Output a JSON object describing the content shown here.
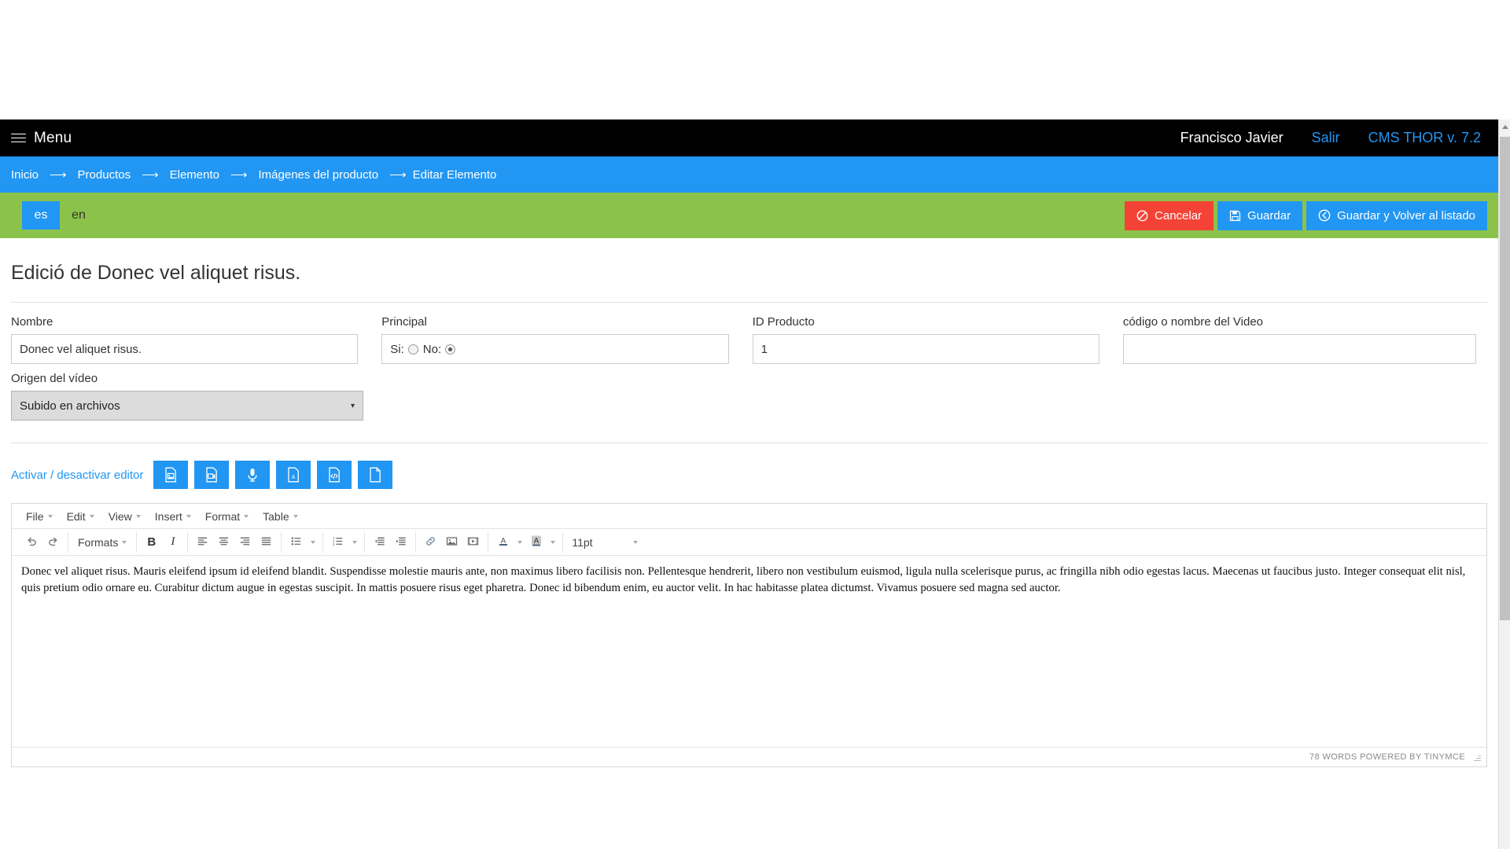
{
  "navbar": {
    "menu_label": "Menu",
    "menu_icon": "hamburger-icon",
    "user": "Francisco Javier",
    "logout": "Salir",
    "version": "CMS THOR v. 7.2"
  },
  "breadcrumb": {
    "separator": "⟶",
    "items": [
      {
        "label": "Inicio"
      },
      {
        "label": "Productos"
      },
      {
        "label": "Elemento"
      },
      {
        "label": "Imágenes del producto"
      },
      {
        "label": "Editar Elemento"
      }
    ]
  },
  "actionbar": {
    "languages": [
      {
        "code": "es",
        "active": true
      },
      {
        "code": "en",
        "active": false
      }
    ],
    "buttons": [
      {
        "label": "Cancelar",
        "icon": "ban-icon",
        "color": "#f44336"
      },
      {
        "label": "Guardar",
        "icon": "floppy-save-icon",
        "color": "#2196f3"
      },
      {
        "label": "Guardar y Volver al listado",
        "icon": "arrow-circle-left-icon",
        "color": "#2196f3"
      }
    ]
  },
  "page": {
    "title": "Edició de Donec vel aliquet risus."
  },
  "form": {
    "nombre": {
      "label": "Nombre",
      "value": "Donec vel aliquet risus.",
      "placeholder": ""
    },
    "principal": {
      "label": "Principal",
      "si_label": "Si:",
      "no_label": "No:",
      "si_checked": false,
      "no_checked": true
    },
    "id_producto": {
      "label": "ID Producto",
      "value": "1",
      "placeholder": ""
    },
    "codigo_video": {
      "label": "código o nombre del Video",
      "value": "",
      "placeholder": ""
    },
    "origen_video": {
      "label": "Origen del vídeo",
      "value": "Subido en archivos",
      "caret": "▾"
    }
  },
  "editor_strip": {
    "toggle_label": "Activar / desactivar editor",
    "buttons": [
      {
        "icon": "file-image-icon"
      },
      {
        "icon": "file-video-icon"
      },
      {
        "icon": "microphone-icon"
      },
      {
        "icon": "file-pdf-icon"
      },
      {
        "icon": "file-code-icon"
      },
      {
        "icon": "file-blank-icon"
      }
    ]
  },
  "tinymce": {
    "menubar": [
      {
        "label": "File"
      },
      {
        "label": "Edit"
      },
      {
        "label": "View"
      },
      {
        "label": "Insert"
      },
      {
        "label": "Format"
      },
      {
        "label": "Table"
      }
    ],
    "toolbar": {
      "undo": "undo-icon",
      "redo": "redo-icon",
      "formats_label": "Formats",
      "bold": "B",
      "italic": "I",
      "align_left": "align-left-icon",
      "align_center": "align-center-icon",
      "align_right": "align-right-icon",
      "align_justify": "align-justify-icon",
      "bullist": "bullet-list-icon",
      "numlist": "numbered-list-icon",
      "outdent": "outdent-icon",
      "indent": "indent-icon",
      "link": "link-icon",
      "image": "image-icon",
      "media": "media-icon",
      "forecolor": "A",
      "backcolor": "A",
      "fontsize_value": "11pt"
    },
    "content": "Donec vel aliquet risus. Mauris eleifend ipsum id eleifend blandit. Suspendisse molestie mauris ante, non maximus libero facilisis non. Pellentesque hendrerit, libero non vestibulum euismod, ligula nulla scelerisque purus, ac fringilla nibh odio egestas lacus. Maecenas ut faucibus justo. Integer consequat elit nisl, quis pretium odio ornare eu. Curabitur dictum augue in egestas suscipit. In mattis posuere risus eget pharetra. Donec id bibendum enim, eu auctor velit. In hac habitasse platea dictumst. Vivamus posuere sed magna sed auctor.",
    "statusbar": "78 WORDS POWERED BY TINYMCE"
  }
}
